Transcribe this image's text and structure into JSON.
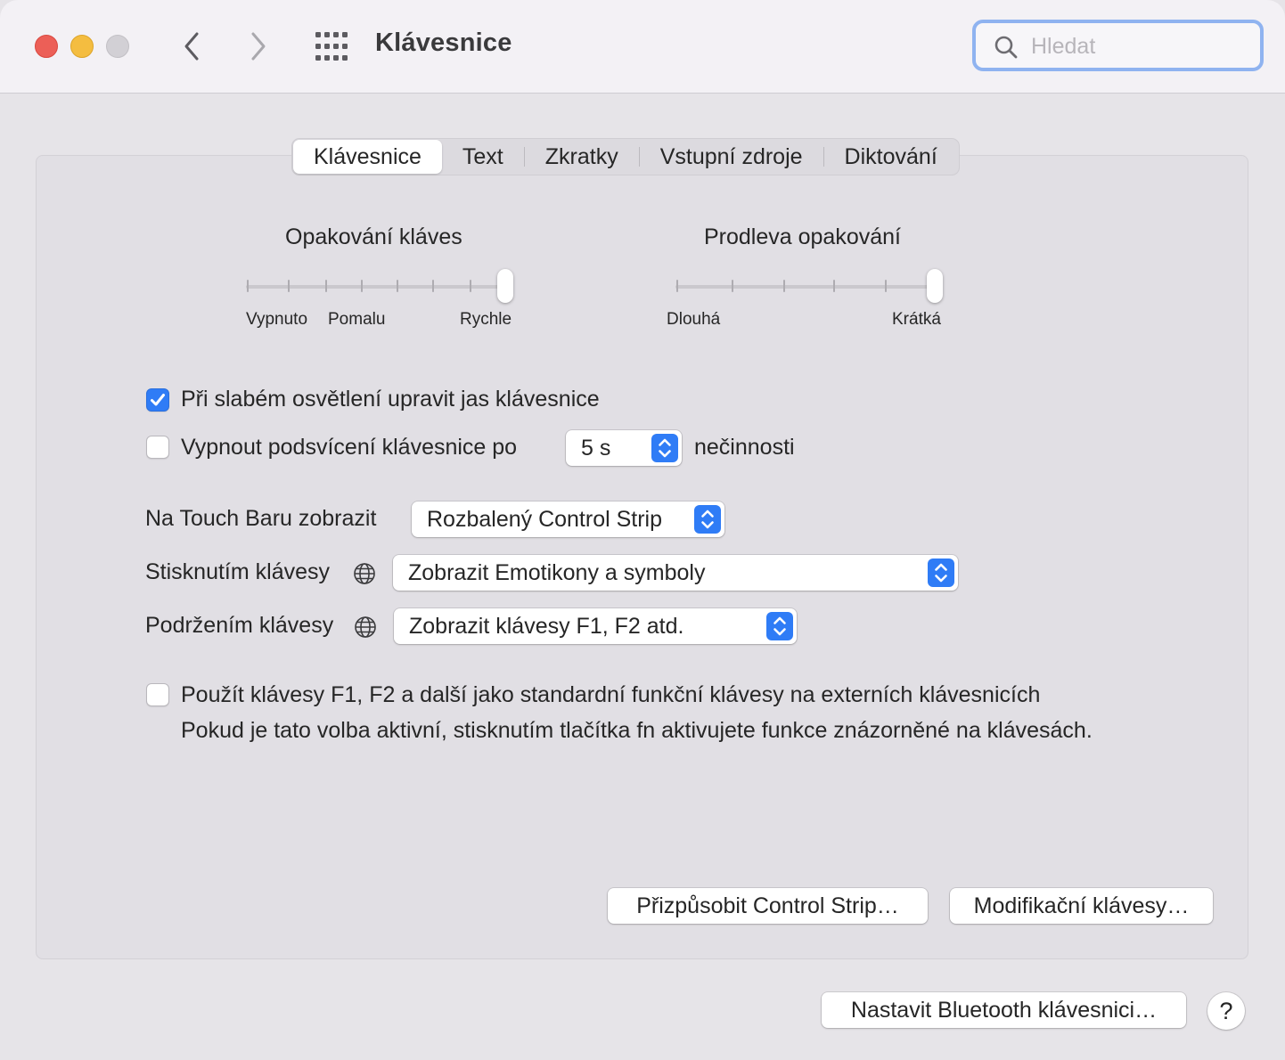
{
  "window": {
    "title": "Klávesnice",
    "search_placeholder": "Hledat"
  },
  "tabs": [
    {
      "label": "Klávesnice",
      "active": true
    },
    {
      "label": "Text",
      "active": false
    },
    {
      "label": "Zkratky",
      "active": false
    },
    {
      "label": "Vstupní zdroje",
      "active": false
    },
    {
      "label": "Diktování",
      "active": false
    }
  ],
  "key_repeat": {
    "title": "Opakování kláves",
    "labels": [
      "Vypnuto",
      "Pomalu",
      "Rychle"
    ],
    "level_fraction": 1.0
  },
  "repeat_delay": {
    "title": "Prodleva opakování",
    "labels": [
      "Dlouhá",
      "Krátká"
    ],
    "level_fraction": 1.0
  },
  "options": {
    "adjust_brightness": {
      "label": "Při slabém osvětlení upravit jas klávesnice",
      "checked": true
    },
    "backlight_off": {
      "label": "Vypnout podsvícení klávesnice po",
      "checked": false,
      "value": "5 s",
      "suffix": "nečinnosti"
    },
    "touch_bar": {
      "label": "Na Touch Baru zobrazit",
      "value": "Rozbalený Control Strip"
    },
    "press_key": {
      "label": "Stisknutím klávesy",
      "value": "Zobrazit Emotikony a symboly"
    },
    "hold_key": {
      "label": "Podržením klávesy",
      "value": "Zobrazit klávesy F1, F2 atd."
    },
    "fn_keys": {
      "label": "Použít klávesy F1, F2 a další jako standardní funkční klávesy na externích klávesnicích",
      "description": "Pokud je tato volba aktivní, stisknutím tlačítka fn aktivujete funkce znázorněné na klávesách.",
      "checked": false
    }
  },
  "buttons": {
    "customize_control_strip": "Přizpůsobit Control Strip…",
    "modifier_keys": "Modifikační klávesy…",
    "bluetooth_keyboard": "Nastavit Bluetooth klávesnici…",
    "help": "?"
  },
  "colors": {
    "accent": "#2f7cf6",
    "close": "#ec5f57",
    "minimize": "#f4bd40",
    "maximize": "#d2d0d5"
  }
}
